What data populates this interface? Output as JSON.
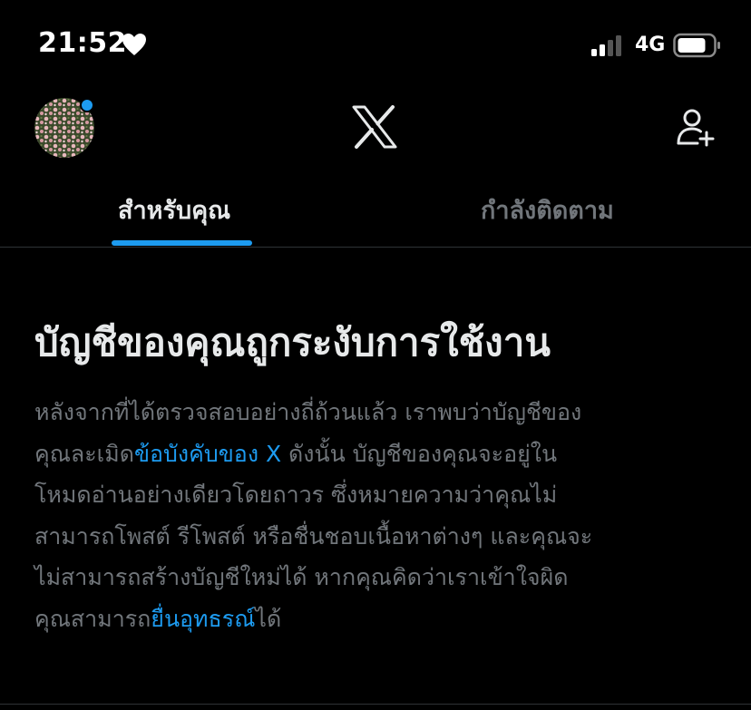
{
  "status_bar": {
    "time": "21:52",
    "network": "4G"
  },
  "nav": {
    "tab_for_you": "สำหรับคุณ",
    "tab_following": "กำลังติดตาม"
  },
  "notice": {
    "title": "บัญชีของคุณถูกระงับการใช้งาน",
    "lines": [
      [
        "หลังจากที่ได้ตรวจสอบอย่างถี่ถ้วนแล้ว เราพบว่าบัญชีของ"
      ],
      [
        "คุณละเมิด",
        "ข้อบังคับของ X",
        " ดังนั้น บัญชีของคุณจะอยู่ใน"
      ],
      [
        "โหมดอ่านอย่างเดียวโดยถาวร ซึ่งหมายความว่าคุณไม่"
      ],
      [
        "สามารถโพสต์ รีโพสต์ หรือชื่นชอบเนื้อหาต่างๆ และคุณจะ"
      ],
      [
        "ไม่สามารถสร้างบัญชีใหม่ได้ หากคุณคิดว่าเราเข้าใจผิด"
      ],
      [
        "คุณสามารถ",
        "ยื่นอุทธรณ์",
        "ได้"
      ]
    ]
  },
  "icons": {
    "heart": "heart-icon",
    "signal": "signal-icon",
    "battery": "battery-icon",
    "logo": "x-logo",
    "follow": "add-user-icon",
    "avatar": "flower-avatar"
  },
  "colors": {
    "accent": "#1d9bf0",
    "background": "#000000",
    "primary_text": "#e7e9ea",
    "secondary_text": "#71767b"
  }
}
